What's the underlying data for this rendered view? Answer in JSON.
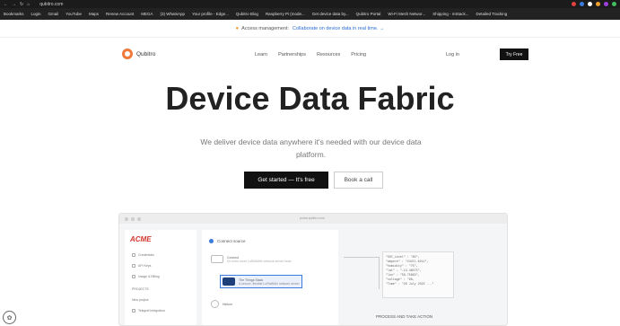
{
  "browser": {
    "url": "qubitro.com"
  },
  "bookmarks": [
    "Bookmarks",
    "Login",
    "Gmail",
    "YouTube",
    "Maps",
    "Renew Account",
    "MEGA",
    "(3) WhatsApp",
    "Your profile - Edge...",
    "Qubitro Blog",
    "Raspberry Pi (mode...",
    "Get device data by...",
    "Qubitro Portal",
    "Wi-Fi Mesh Networ...",
    "Shipping - mStack...",
    "Detailed Tracking"
  ],
  "announcement": {
    "text": "Access management:",
    "link": "Collaborate on device data in real time. →"
  },
  "header": {
    "logo_text": "Qubitro",
    "nav": [
      "Learn",
      "Partnerships",
      "Resources",
      "Pricing"
    ],
    "login": "Log in",
    "try_free": "Try Free"
  },
  "hero": {
    "title": "Device Data Fabric",
    "subtitle": "We deliver device data anywhere it's needed with our device data platform.",
    "cta_primary": "Get started — It's free",
    "cta_secondary": "Book a call"
  },
  "app_preview": {
    "url": "portal.qubitro.com",
    "brand": "ACME",
    "sidebar_items": [
      "Credentials",
      "API Keys",
      "Usage & Billing",
      "PROJECTS",
      "New project",
      "Telegraf Integration"
    ],
    "connect_source": "Connect source",
    "cards": [
      {
        "title": "Connect",
        "sub": "Do even more LoRaWAN network server tools"
      },
      {
        "title": "The Things Stack",
        "sub": "A secure, flexible LoRaWAN network server"
      },
      {
        "title": "Helium",
        "sub": ""
      }
    ],
    "json_lines": [
      "\"SOC_Level\" : \"85\",",
      "\"ampere\" : \"24471.6211\",",
      "\"humidity\" : \"75\",",
      "\"lat\" : \"-13.46575\",",
      "\"lon\" : \"56.75863\",",
      "\"voltage\" : \"98,",
      "\"Time\" : \"26 July 2023 ...\""
    ],
    "process_label": "PROCESS AND TAKE ACTION"
  }
}
